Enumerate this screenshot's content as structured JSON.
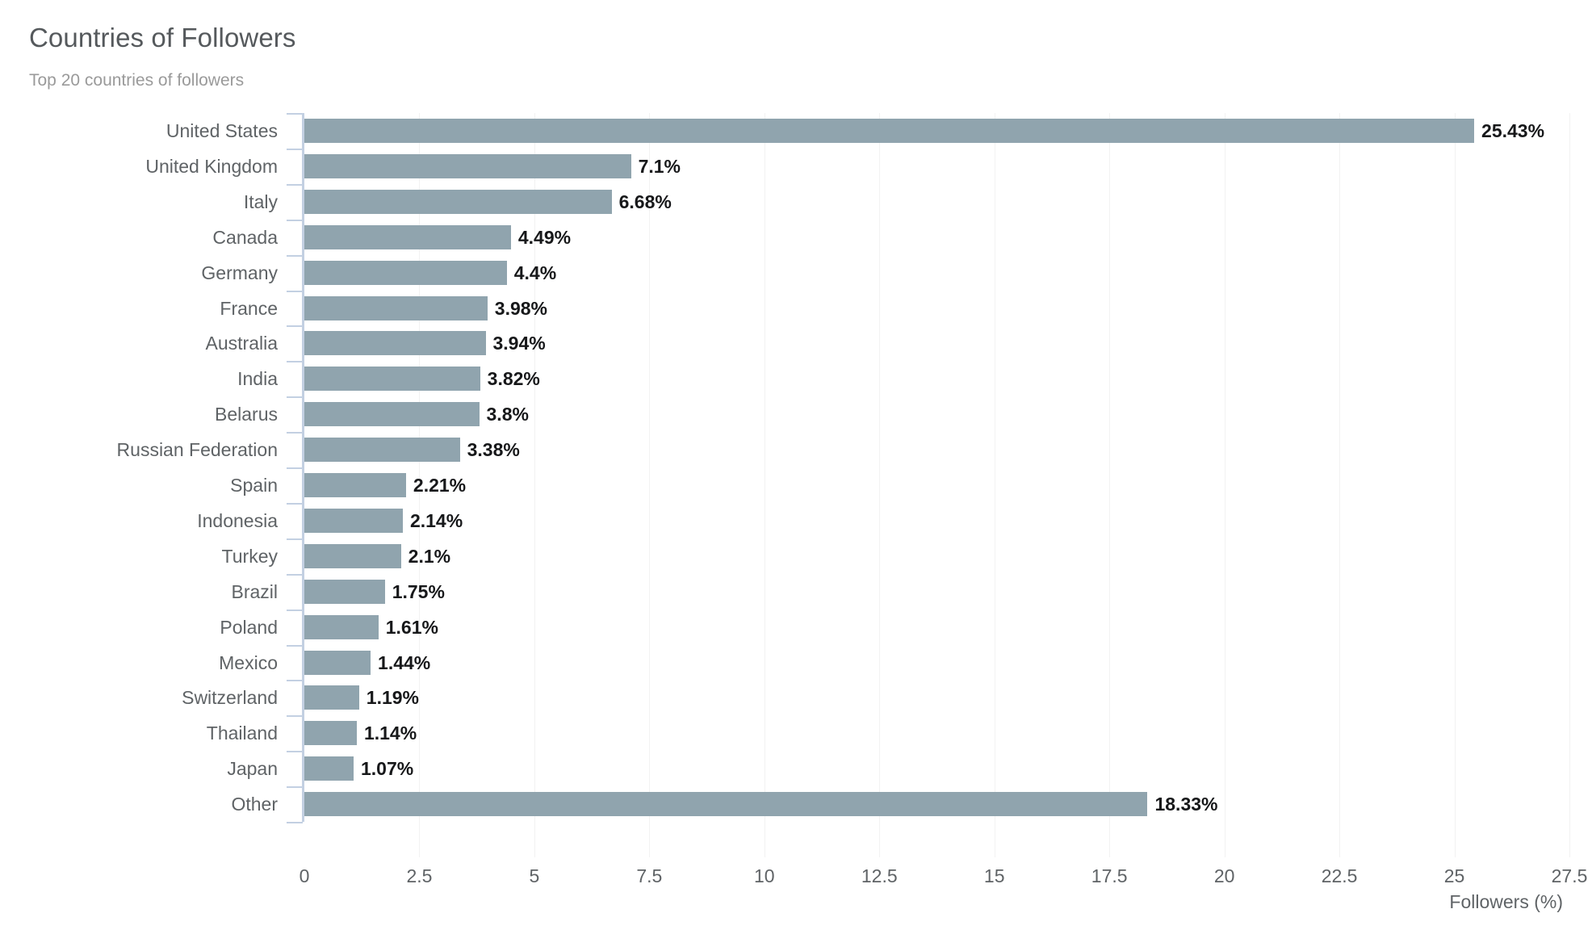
{
  "header": {
    "title": "Countries of Followers",
    "subtitle": "Top 20 countries of followers",
    "menu_icon": "hamburger-menu-icon"
  },
  "colors": {
    "bar": "#90a4ae",
    "title": "#55595c",
    "subtitle": "#9a9a9a",
    "axis": "#c3d0e2",
    "gridline": "#f2f2f2",
    "tick_text": "#5f6366",
    "value_label": "#17181a",
    "menu_icon": "#cfcfcf",
    "background": "#ffffff"
  },
  "chart_data": {
    "type": "bar",
    "orientation": "horizontal",
    "title": "Countries of Followers",
    "subtitle": "Top 20 countries of followers",
    "xlabel": "Followers (%)",
    "ylabel": "",
    "xlim": [
      0,
      27.5
    ],
    "xticks": [
      0,
      2.5,
      5,
      7.5,
      10,
      12.5,
      15,
      17.5,
      20,
      22.5,
      25,
      27.5
    ],
    "xtick_labels": [
      "0",
      "2.5",
      "5",
      "7.5",
      "10",
      "12.5",
      "15",
      "17.5",
      "20",
      "22.5",
      "25",
      "27.5"
    ],
    "grid": true,
    "legend": false,
    "categories": [
      "United States",
      "United Kingdom",
      "Italy",
      "Canada",
      "Germany",
      "France",
      "Australia",
      "India",
      "Belarus",
      "Russian Federation",
      "Spain",
      "Indonesia",
      "Turkey",
      "Brazil",
      "Poland",
      "Mexico",
      "Switzerland",
      "Thailand",
      "Japan",
      "Other"
    ],
    "values": [
      25.43,
      7.1,
      6.68,
      4.49,
      4.4,
      3.98,
      3.94,
      3.82,
      3.8,
      3.38,
      2.21,
      2.14,
      2.1,
      1.75,
      1.61,
      1.44,
      1.19,
      1.14,
      1.07,
      18.33
    ],
    "value_labels": [
      "25.43%",
      "7.1%",
      "6.68%",
      "4.49%",
      "4.4%",
      "3.98%",
      "3.94%",
      "3.82%",
      "3.8%",
      "3.38%",
      "2.21%",
      "2.14%",
      "2.1%",
      "1.75%",
      "1.61%",
      "1.44%",
      "1.19%",
      "1.14%",
      "1.07%",
      "18.33%"
    ]
  }
}
